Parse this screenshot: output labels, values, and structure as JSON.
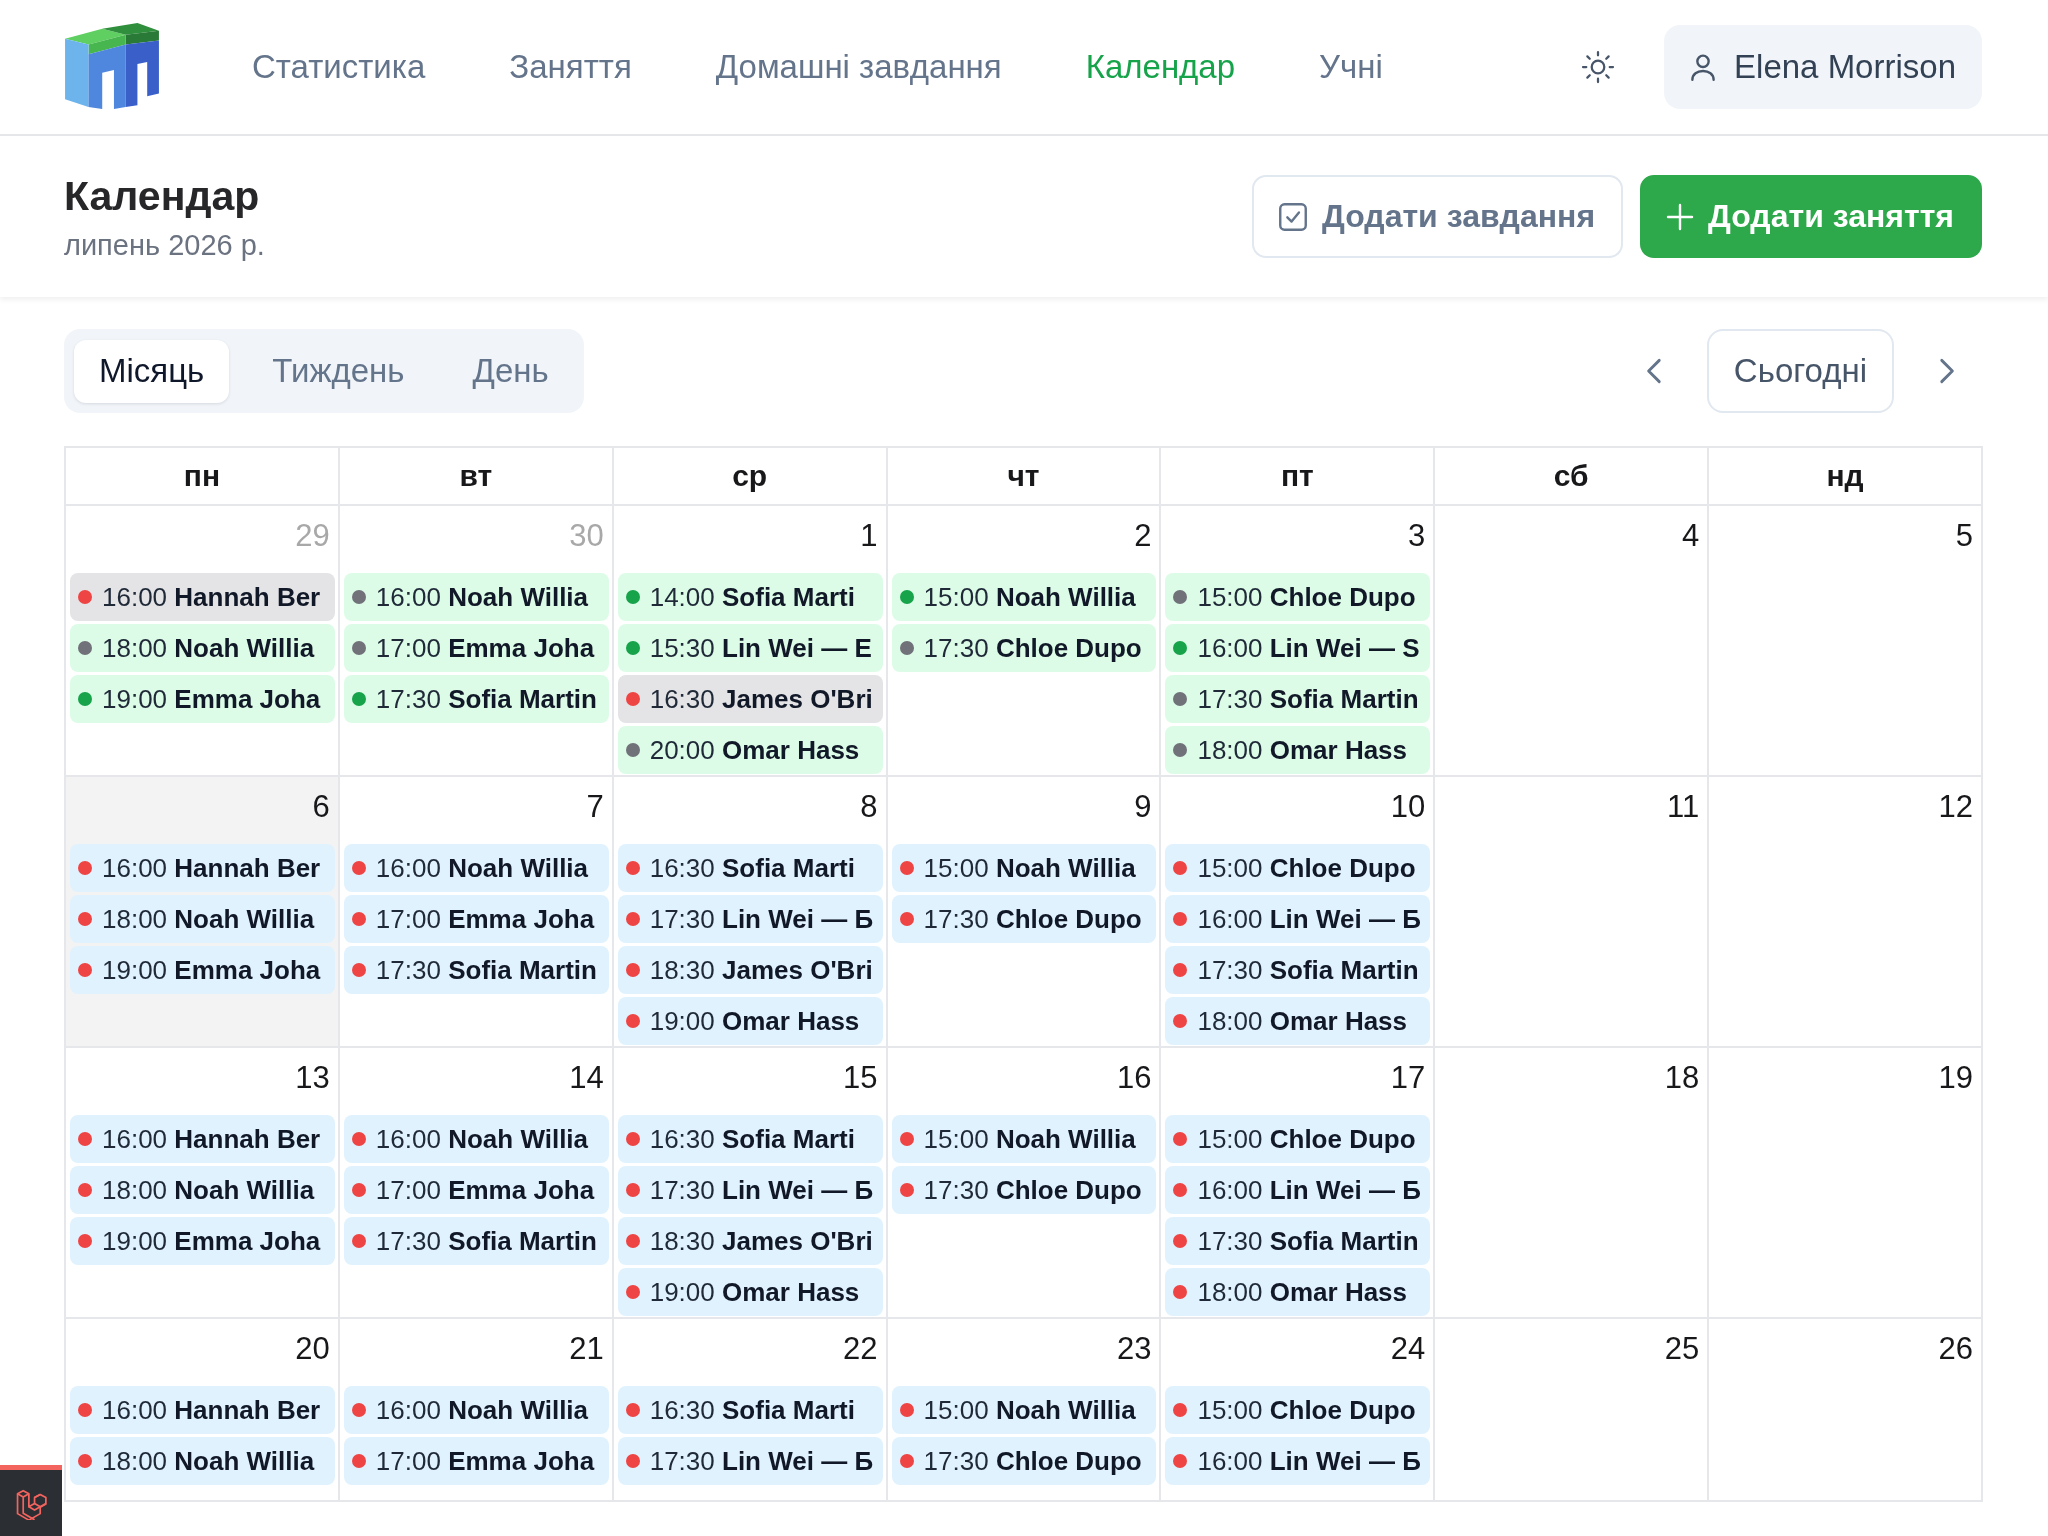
{
  "nav": {
    "items": [
      {
        "label": "Статистика",
        "selected": false
      },
      {
        "label": "Заняття",
        "selected": false
      },
      {
        "label": "Домашні завдання",
        "selected": false
      },
      {
        "label": "Календар",
        "selected": true
      },
      {
        "label": "Учні",
        "selected": false
      }
    ]
  },
  "user": {
    "name": "Elena Morrison"
  },
  "page_header": {
    "title": "Календар",
    "subtitle": "липень 2026 р.",
    "actions": [
      {
        "label": "Додати завдання",
        "kind": "secondary"
      },
      {
        "label": "Додати заняття",
        "kind": "primary"
      }
    ]
  },
  "view_switch": [
    {
      "label": "Місяць",
      "selected": true
    },
    {
      "label": "Тиждень",
      "selected": false
    },
    {
      "label": "День",
      "selected": false
    }
  ],
  "today_button": "Сьогодні",
  "calendar": {
    "weekdays": [
      "пн",
      "вт",
      "ср",
      "чт",
      "пт",
      "сб",
      "нд"
    ],
    "weeks": [
      {
        "days": [
          {
            "day": "29",
            "outside_month": true,
            "today": false,
            "events": [
              {
                "time": "16:00",
                "title": "Hannah Ber",
                "kind": "cancelled",
                "color": "#ef4444"
              },
              {
                "time": "18:00",
                "title": "Noah Willia",
                "kind": "completed",
                "color": "#71717a"
              },
              {
                "time": "19:00",
                "title": "Emma Joha",
                "kind": "completed",
                "color": "#16a34a"
              }
            ]
          },
          {
            "day": "30",
            "outside_month": true,
            "today": false,
            "events": [
              {
                "time": "16:00",
                "title": "Noah Willia",
                "kind": "completed",
                "color": "#71717a"
              },
              {
                "time": "17:00",
                "title": "Emma Joha",
                "kind": "completed",
                "color": "#71717a"
              },
              {
                "time": "17:30",
                "title": "Sofia Martin",
                "kind": "completed",
                "color": "#16a34a"
              }
            ]
          },
          {
            "day": "1",
            "outside_month": false,
            "today": false,
            "events": [
              {
                "time": "14:00",
                "title": "Sofia Marti",
                "kind": "completed",
                "color": "#16a34a"
              },
              {
                "time": "15:30",
                "title": "Lin Wei — E",
                "kind": "completed",
                "color": "#16a34a"
              },
              {
                "time": "16:30",
                "title": "James O'Bri",
                "kind": "cancelled",
                "color": "#ef4444"
              },
              {
                "time": "20:00",
                "title": "Omar Hass",
                "kind": "completed",
                "color": "#71717a"
              }
            ]
          },
          {
            "day": "2",
            "outside_month": false,
            "today": false,
            "events": [
              {
                "time": "15:00",
                "title": "Noah Willia",
                "kind": "completed",
                "color": "#16a34a"
              },
              {
                "time": "17:30",
                "title": "Chloe Dupo",
                "kind": "completed",
                "color": "#71717a"
              }
            ]
          },
          {
            "day": "3",
            "outside_month": false,
            "today": false,
            "events": [
              {
                "time": "15:00",
                "title": "Chloe Dupo",
                "kind": "completed",
                "color": "#71717a"
              },
              {
                "time": "16:00",
                "title": "Lin Wei — S",
                "kind": "completed",
                "color": "#16a34a"
              },
              {
                "time": "17:30",
                "title": "Sofia Martin",
                "kind": "completed",
                "color": "#71717a"
              },
              {
                "time": "18:00",
                "title": "Omar Hass",
                "kind": "completed",
                "color": "#71717a"
              }
            ]
          },
          {
            "day": "4",
            "outside_month": false,
            "today": false
          },
          {
            "day": "5",
            "outside_month": false,
            "today": false
          }
        ]
      },
      {
        "days": [
          {
            "day": "6",
            "outside_month": false,
            "today": true,
            "events": [
              {
                "time": "16:00",
                "title": "Hannah Ber",
                "kind": "scheduled",
                "color": "#ef4444"
              },
              {
                "time": "18:00",
                "title": "Noah Willia",
                "kind": "scheduled",
                "color": "#ef4444"
              },
              {
                "time": "19:00",
                "title": "Emma Joha",
                "kind": "scheduled",
                "color": "#ef4444"
              }
            ]
          },
          {
            "day": "7",
            "outside_month": false,
            "today": false,
            "events": [
              {
                "time": "16:00",
                "title": "Noah Willia",
                "kind": "scheduled",
                "color": "#ef4444"
              },
              {
                "time": "17:00",
                "title": "Emma Joha",
                "kind": "scheduled",
                "color": "#ef4444"
              },
              {
                "time": "17:30",
                "title": "Sofia Martin",
                "kind": "scheduled",
                "color": "#ef4444"
              }
            ]
          },
          {
            "day": "8",
            "outside_month": false,
            "today": false,
            "events": [
              {
                "time": "16:30",
                "title": "Sofia Marti",
                "kind": "scheduled",
                "color": "#ef4444"
              },
              {
                "time": "17:30",
                "title": "Lin Wei — Б",
                "kind": "scheduled",
                "color": "#ef4444"
              },
              {
                "time": "18:30",
                "title": "James O'Bri",
                "kind": "scheduled",
                "color": "#ef4444"
              },
              {
                "time": "19:00",
                "title": "Omar Hass",
                "kind": "scheduled",
                "color": "#ef4444"
              }
            ]
          },
          {
            "day": "9",
            "outside_month": false,
            "today": false,
            "events": [
              {
                "time": "15:00",
                "title": "Noah Willia",
                "kind": "scheduled",
                "color": "#ef4444"
              },
              {
                "time": "17:30",
                "title": "Chloe Dupo",
                "kind": "scheduled",
                "color": "#ef4444"
              }
            ]
          },
          {
            "day": "10",
            "outside_month": false,
            "today": false,
            "events": [
              {
                "time": "15:00",
                "title": "Chloe Dupo",
                "kind": "scheduled",
                "color": "#ef4444"
              },
              {
                "time": "16:00",
                "title": "Lin Wei — Б",
                "kind": "scheduled",
                "color": "#ef4444"
              },
              {
                "time": "17:30",
                "title": "Sofia Martin",
                "kind": "scheduled",
                "color": "#ef4444"
              },
              {
                "time": "18:00",
                "title": "Omar Hass",
                "kind": "scheduled",
                "color": "#ef4444"
              }
            ]
          },
          {
            "day": "11",
            "outside_month": false,
            "today": false
          },
          {
            "day": "12",
            "outside_month": false,
            "today": false
          }
        ]
      },
      {
        "days": [
          {
            "day": "13",
            "outside_month": false,
            "today": false,
            "events": [
              {
                "time": "16:00",
                "title": "Hannah Ber",
                "kind": "scheduled",
                "color": "#ef4444"
              },
              {
                "time": "18:00",
                "title": "Noah Willia",
                "kind": "scheduled",
                "color": "#ef4444"
              },
              {
                "time": "19:00",
                "title": "Emma Joha",
                "kind": "scheduled",
                "color": "#ef4444"
              }
            ]
          },
          {
            "day": "14",
            "outside_month": false,
            "today": false,
            "events": [
              {
                "time": "16:00",
                "title": "Noah Willia",
                "kind": "scheduled",
                "color": "#ef4444"
              },
              {
                "time": "17:00",
                "title": "Emma Joha",
                "kind": "scheduled",
                "color": "#ef4444"
              },
              {
                "time": "17:30",
                "title": "Sofia Martin",
                "kind": "scheduled",
                "color": "#ef4444"
              }
            ]
          },
          {
            "day": "15",
            "outside_month": false,
            "today": false,
            "events": [
              {
                "time": "16:30",
                "title": "Sofia Marti",
                "kind": "scheduled",
                "color": "#ef4444"
              },
              {
                "time": "17:30",
                "title": "Lin Wei — Б",
                "kind": "scheduled",
                "color": "#ef4444"
              },
              {
                "time": "18:30",
                "title": "James O'Bri",
                "kind": "scheduled",
                "color": "#ef4444"
              },
              {
                "time": "19:00",
                "title": "Omar Hass",
                "kind": "scheduled",
                "color": "#ef4444"
              }
            ]
          },
          {
            "day": "16",
            "outside_month": false,
            "today": false,
            "events": [
              {
                "time": "15:00",
                "title": "Noah Willia",
                "kind": "scheduled",
                "color": "#ef4444"
              },
              {
                "time": "17:30",
                "title": "Chloe Dupo",
                "kind": "scheduled",
                "color": "#ef4444"
              }
            ]
          },
          {
            "day": "17",
            "outside_month": false,
            "today": false,
            "events": [
              {
                "time": "15:00",
                "title": "Chloe Dupo",
                "kind": "scheduled",
                "color": "#ef4444"
              },
              {
                "time": "16:00",
                "title": "Lin Wei — Б",
                "kind": "scheduled",
                "color": "#ef4444"
              },
              {
                "time": "17:30",
                "title": "Sofia Martin",
                "kind": "scheduled",
                "color": "#ef4444"
              },
              {
                "time": "18:00",
                "title": "Omar Hass",
                "kind": "scheduled",
                "color": "#ef4444"
              }
            ]
          },
          {
            "day": "18",
            "outside_month": false,
            "today": false
          },
          {
            "day": "19",
            "outside_month": false,
            "today": false
          }
        ]
      },
      {
        "days": [
          {
            "day": "20",
            "outside_month": false,
            "today": false,
            "events": [
              {
                "time": "16:00",
                "title": "Hannah Ber",
                "kind": "scheduled",
                "color": "#ef4444"
              },
              {
                "time": "18:00",
                "title": "Noah Willia",
                "kind": "scheduled",
                "color": "#ef4444"
              }
            ]
          },
          {
            "day": "21",
            "outside_month": false,
            "today": false,
            "events": [
              {
                "time": "16:00",
                "title": "Noah Willia",
                "kind": "scheduled",
                "color": "#ef4444"
              },
              {
                "time": "17:00",
                "title": "Emma Joha",
                "kind": "scheduled",
                "color": "#ef4444"
              }
            ]
          },
          {
            "day": "22",
            "outside_month": false,
            "today": false,
            "events": [
              {
                "time": "16:30",
                "title": "Sofia Marti",
                "kind": "scheduled",
                "color": "#ef4444"
              },
              {
                "time": "17:30",
                "title": "Lin Wei — Б",
                "kind": "scheduled",
                "color": "#ef4444"
              }
            ]
          },
          {
            "day": "23",
            "outside_month": false,
            "today": false,
            "events": [
              {
                "time": "15:00",
                "title": "Noah Willia",
                "kind": "scheduled",
                "color": "#ef4444"
              },
              {
                "time": "17:30",
                "title": "Chloe Dupo",
                "kind": "scheduled",
                "color": "#ef4444"
              }
            ]
          },
          {
            "day": "24",
            "outside_month": false,
            "today": false,
            "events": [
              {
                "time": "15:00",
                "title": "Chloe Dupo",
                "kind": "scheduled",
                "color": "#ef4444"
              },
              {
                "time": "16:00",
                "title": "Lin Wei — Б",
                "kind": "scheduled",
                "color": "#ef4444"
              }
            ]
          },
          {
            "day": "25",
            "outside_month": false,
            "today": false
          },
          {
            "day": "26",
            "outside_month": false,
            "today": false
          }
        ]
      }
    ]
  }
}
